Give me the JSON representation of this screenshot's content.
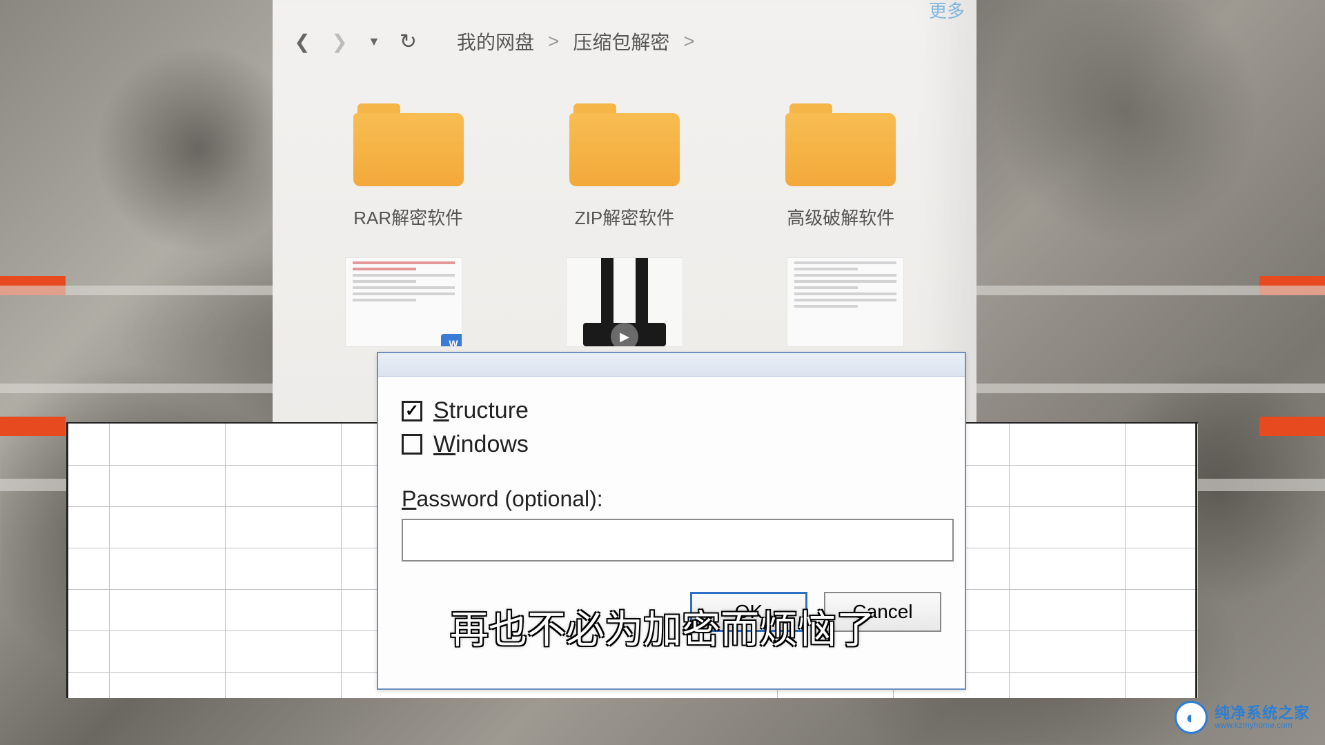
{
  "breadcrumb": {
    "root": "我的网盘",
    "folder": "压缩包解密",
    "sep": ">"
  },
  "folders": [
    {
      "label": "RAR解密软件"
    },
    {
      "label": "ZIP解密软件"
    },
    {
      "label": "高级破解软件"
    }
  ],
  "doc_badge": "W",
  "dialog": {
    "checkbox_structure": {
      "label_underline": "S",
      "label_rest": "tructure",
      "checked": true
    },
    "checkbox_windows": {
      "label_underline": "W",
      "label_rest": "indows",
      "checked": false
    },
    "password_label_underline": "P",
    "password_label_rest": "assword (optional):",
    "password_value": "",
    "ok": "OK",
    "cancel": "Cancel"
  },
  "caption": "再也不必为加密而烦恼了",
  "watermark": {
    "title": "纯净系统之家",
    "url": "www.kzmyhome.com"
  },
  "more_label": "更多"
}
